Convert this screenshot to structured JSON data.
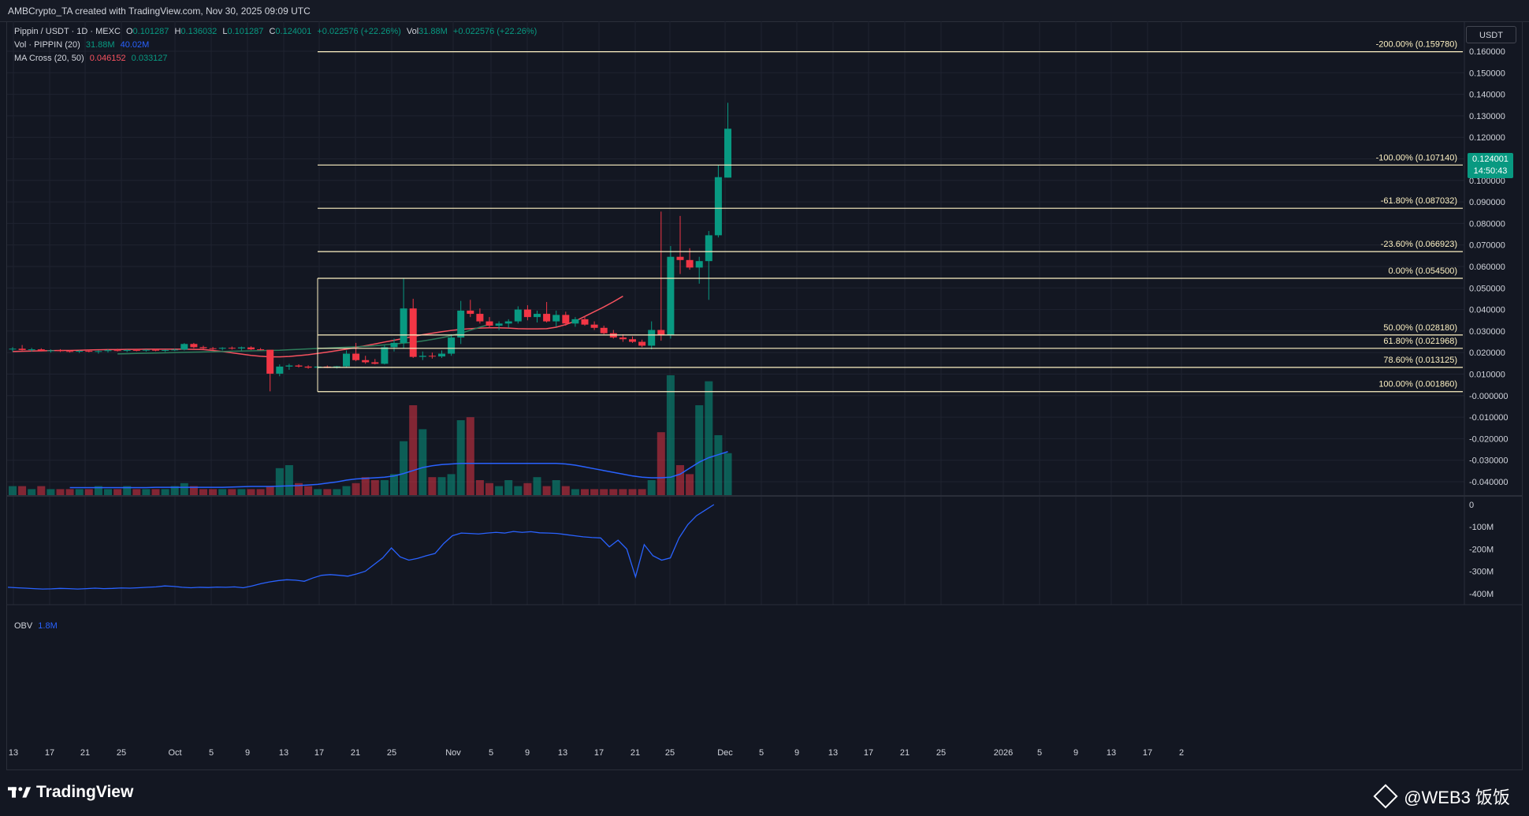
{
  "header": {
    "attribution": "AMBCrypto_TA created with TradingView.com, Nov 30, 2025 09:09 UTC"
  },
  "legend": {
    "symbol": "Pippin / USDT · 1D · MEXC",
    "o_label": "O",
    "o": "0.101287",
    "h_label": "H",
    "h": "0.136032",
    "l_label": "L",
    "l": "0.101287",
    "c_label": "C",
    "c": "0.124001",
    "change": "+0.022576 (+22.26%)",
    "vol_label": "Vol",
    "vol": "31.88M",
    "vol_change": "+0.022576 (+22.26%)",
    "volume_indicator": "Vol · PIPPIN (20)",
    "volume_value": "31.88M",
    "volume_ma": "40.02M",
    "ma_cross": "MA Cross (20, 50)",
    "ma_fast": "0.046152",
    "ma_slow": "0.033127",
    "obv_label": "OBV",
    "obv_value": "1.8M"
  },
  "price_scale": {
    "currency": "USDT",
    "last_price": "0.124001",
    "countdown": "14:50:43"
  },
  "colors": {
    "up": "#089981",
    "down": "#f23645",
    "fib": "#fff3c4",
    "ma_fast": "#f7525f",
    "ma_slow": "#2e7d5b",
    "volume_ma": "#2962ff",
    "obv": "#2962ff"
  },
  "footer": {
    "brand": "TradingView",
    "watermark": "@WEB3 饭饭"
  },
  "chart_data": [
    {
      "type": "candlestick",
      "title": "Pippin / USDT · 1D · MEXC",
      "x_ticks": [
        "13",
        "17",
        "21",
        "25",
        "Oct",
        "5",
        "9",
        "13",
        "17",
        "21",
        "25",
        "Nov",
        "5",
        "9",
        "13",
        "17",
        "21",
        "25",
        "Dec",
        "5",
        "9",
        "13",
        "17",
        "21",
        "25",
        "2026",
        "5",
        "9",
        "13",
        "17",
        "2"
      ],
      "y_ticks": [
        "0.160000",
        "0.150000",
        "0.140000",
        "0.130000",
        "0.120000",
        "0.110000",
        "0.100000",
        "0.090000",
        "0.080000",
        "0.070000",
        "0.060000",
        "0.050000",
        "0.040000",
        "0.030000",
        "0.020000",
        "0.010000",
        "-0.000000",
        "-0.010000",
        "-0.020000",
        "-0.030000",
        "-0.040000"
      ],
      "ylim": [
        -0.045,
        0.166
      ],
      "fib_levels": [
        {
          "label": "-200.00% (0.159780)",
          "value": 0.15978
        },
        {
          "label": "-100.00% (0.107140)",
          "value": 0.10714
        },
        {
          "label": "-61.80% (0.087032)",
          "value": 0.087032
        },
        {
          "label": "-23.60% (0.066923)",
          "value": 0.066923
        },
        {
          "label": "0.00% (0.054500)",
          "value": 0.0545
        },
        {
          "label": "50.00% (0.028180)",
          "value": 0.02818
        },
        {
          "label": "61.80% (0.021968)",
          "value": 0.021968
        },
        {
          "label": "78.60% (0.013125)",
          "value": 0.013125
        },
        {
          "label": "100.00% (0.001860)",
          "value": 0.00186
        }
      ],
      "candles": [
        [
          0.0215,
          0.0225,
          0.0205,
          0.0218
        ],
        [
          0.0218,
          0.0235,
          0.021,
          0.0212
        ],
        [
          0.0212,
          0.0222,
          0.0205,
          0.0215
        ],
        [
          0.0215,
          0.022,
          0.0205,
          0.0209
        ],
        [
          0.0209,
          0.0215,
          0.02,
          0.021
        ],
        [
          0.021,
          0.0216,
          0.0203,
          0.0207
        ],
        [
          0.0207,
          0.0212,
          0.02,
          0.0205
        ],
        [
          0.0205,
          0.0211,
          0.0198,
          0.0208
        ],
        [
          0.0208,
          0.0214,
          0.0201,
          0.0204
        ],
        [
          0.0204,
          0.021,
          0.0195,
          0.0207
        ],
        [
          0.0207,
          0.0215,
          0.02,
          0.0211
        ],
        [
          0.0211,
          0.0218,
          0.0205,
          0.0209
        ],
        [
          0.0209,
          0.0214,
          0.0202,
          0.0212
        ],
        [
          0.0212,
          0.0218,
          0.0206,
          0.021
        ],
        [
          0.021,
          0.0215,
          0.0204,
          0.0213
        ],
        [
          0.0213,
          0.0218,
          0.0206,
          0.0209
        ],
        [
          0.0209,
          0.0214,
          0.0203,
          0.0212
        ],
        [
          0.0212,
          0.0218,
          0.0207,
          0.0214
        ],
        [
          0.0214,
          0.0244,
          0.021,
          0.024
        ],
        [
          0.024,
          0.0245,
          0.022,
          0.0225
        ],
        [
          0.0225,
          0.0232,
          0.0215,
          0.022
        ],
        [
          0.022,
          0.0226,
          0.0212,
          0.0218
        ],
        [
          0.0218,
          0.0225,
          0.021,
          0.0222
        ],
        [
          0.0222,
          0.0228,
          0.0214,
          0.0219
        ],
        [
          0.0219,
          0.0228,
          0.021,
          0.0224
        ],
        [
          0.0224,
          0.0229,
          0.0212,
          0.0215
        ],
        [
          0.0215,
          0.0221,
          0.021,
          0.0213
        ],
        [
          0.0213,
          0.021,
          0.002,
          0.0102
        ],
        [
          0.0102,
          0.0145,
          0.009,
          0.0135
        ],
        [
          0.0135,
          0.0148,
          0.012,
          0.014
        ],
        [
          0.014,
          0.0146,
          0.013,
          0.0135
        ],
        [
          0.0135,
          0.0141,
          0.0125,
          0.013
        ],
        [
          0.013,
          0.0138,
          0.0124,
          0.0135
        ],
        [
          0.0135,
          0.014,
          0.0128,
          0.0132
        ],
        [
          0.0132,
          0.0138,
          0.0126,
          0.0136
        ],
        [
          0.0136,
          0.021,
          0.013,
          0.0195
        ],
        [
          0.0195,
          0.0245,
          0.016,
          0.0165
        ],
        [
          0.0165,
          0.0185,
          0.0148,
          0.0155
        ],
        [
          0.0155,
          0.017,
          0.0145,
          0.0148
        ],
        [
          0.0148,
          0.0235,
          0.0145,
          0.0225
        ],
        [
          0.0225,
          0.0265,
          0.0205,
          0.0245
        ],
        [
          0.0245,
          0.0545,
          0.022,
          0.0405
        ],
        [
          0.0405,
          0.045,
          0.0175,
          0.018
        ],
        [
          0.018,
          0.0205,
          0.0165,
          0.0185
        ],
        [
          0.0185,
          0.02,
          0.0172,
          0.0182
        ],
        [
          0.0182,
          0.021,
          0.0175,
          0.0195
        ],
        [
          0.0195,
          0.0285,
          0.0185,
          0.027
        ],
        [
          0.027,
          0.044,
          0.024,
          0.0395
        ],
        [
          0.0395,
          0.0445,
          0.0365,
          0.038
        ],
        [
          0.038,
          0.0405,
          0.0335,
          0.0345
        ],
        [
          0.0345,
          0.0365,
          0.0315,
          0.0325
        ],
        [
          0.0325,
          0.0345,
          0.0305,
          0.0335
        ],
        [
          0.0335,
          0.0355,
          0.0315,
          0.0345
        ],
        [
          0.0345,
          0.0415,
          0.0335,
          0.04
        ],
        [
          0.04,
          0.042,
          0.035,
          0.0365
        ],
        [
          0.0365,
          0.0395,
          0.034,
          0.038
        ],
        [
          0.038,
          0.0435,
          0.034,
          0.0345
        ],
        [
          0.0345,
          0.0395,
          0.032,
          0.0375
        ],
        [
          0.0375,
          0.039,
          0.0325,
          0.0335
        ],
        [
          0.0335,
          0.0365,
          0.032,
          0.0355
        ],
        [
          0.0355,
          0.037,
          0.0325,
          0.033
        ],
        [
          0.033,
          0.0345,
          0.0305,
          0.0315
        ],
        [
          0.0315,
          0.0325,
          0.0285,
          0.029
        ],
        [
          0.029,
          0.0305,
          0.0265,
          0.027
        ],
        [
          0.027,
          0.0285,
          0.025,
          0.0262
        ],
        [
          0.0262,
          0.0275,
          0.0245,
          0.025
        ],
        [
          0.025,
          0.026,
          0.0225,
          0.0232
        ],
        [
          0.0232,
          0.0345,
          0.0215,
          0.0305
        ],
        [
          0.0305,
          0.0855,
          0.0255,
          0.028
        ],
        [
          0.028,
          0.0695,
          0.0265,
          0.0645
        ],
        [
          0.0645,
          0.0835,
          0.0565,
          0.063
        ],
        [
          0.063,
          0.0685,
          0.0585,
          0.0595
        ],
        [
          0.0595,
          0.0645,
          0.052,
          0.0625
        ],
        [
          0.0625,
          0.0765,
          0.0445,
          0.0745
        ],
        [
          0.0745,
          0.1072,
          0.0735,
          0.1015
        ],
        [
          0.101287,
          0.136032,
          0.101287,
          0.124001
        ]
      ],
      "ma_fast_series": [
        0.0205,
        0.0206,
        0.0207,
        0.0208,
        0.0209,
        0.021,
        0.021,
        0.0211,
        0.0212,
        0.0213,
        0.0214,
        0.0214,
        0.0215,
        0.0215,
        0.0216,
        0.0216,
        0.0216,
        0.0216,
        0.0216,
        0.0215,
        0.0214,
        0.021,
        0.0205,
        0.0199,
        0.0193,
        0.0187,
        0.0183,
        0.018,
        0.018,
        0.0182,
        0.0186,
        0.019,
        0.0196,
        0.0202,
        0.0209,
        0.0216,
        0.0224,
        0.0232,
        0.024,
        0.0249,
        0.0257,
        0.0266,
        0.0275,
        0.0283,
        0.029,
        0.0297,
        0.0303,
        0.0308,
        0.0311,
        0.0314,
        0.0315,
        0.0315,
        0.0314,
        0.0311,
        0.031,
        0.031,
        0.0311,
        0.0318,
        0.033,
        0.0346,
        0.0368,
        0.039,
        0.0412,
        0.0436,
        0.0462
      ],
      "ma_slow_series": [
        0.0194,
        0.0195,
        0.0196,
        0.0197,
        0.0198,
        0.0199,
        0.02,
        0.0201,
        0.0202,
        0.0203,
        0.0204,
        0.0205,
        0.0206,
        0.0207,
        0.0208,
        0.0209,
        0.021,
        0.0211,
        0.0213,
        0.0215,
        0.0217,
        0.0219,
        0.0221,
        0.0223,
        0.0225,
        0.0227,
        0.0229,
        0.0232,
        0.0236,
        0.024,
        0.0244,
        0.0248,
        0.0254,
        0.0261,
        0.0269,
        0.0279,
        0.029,
        0.0304,
        0.0318,
        0.0331
      ]
    },
    {
      "type": "bar",
      "title": "Vol · PIPPIN (20)",
      "volume_series": [
        3,
        3,
        2,
        3,
        2,
        2,
        2,
        2,
        2,
        3,
        2,
        2,
        3,
        2,
        2,
        2,
        2,
        3,
        4,
        3,
        2,
        2,
        2,
        2,
        2,
        2,
        2,
        3,
        9,
        10,
        4,
        3,
        2,
        2,
        2,
        3,
        4,
        6,
        5,
        5,
        7,
        18,
        30,
        22,
        6,
        6,
        7,
        25,
        26,
        5,
        4,
        3,
        5,
        3,
        4,
        6,
        3,
        5,
        3,
        2,
        2,
        2,
        2,
        2,
        2,
        2,
        2,
        5,
        21,
        40,
        10,
        7,
        30,
        38,
        20,
        14
      ],
      "volume_ma_series": [
        2.5,
        2.5,
        2.5,
        2.5,
        2.5,
        2.5,
        2.5,
        2.5,
        2.5,
        2.6,
        2.6,
        2.6,
        2.6,
        2.6,
        2.6,
        2.6,
        2.6,
        2.7,
        2.8,
        2.9,
        2.9,
        2.9,
        3.0,
        3.1,
        3.2,
        3.4,
        3.6,
        4.0,
        4.4,
        5.0,
        5.4,
        5.6,
        5.8,
        6.0,
        6.4,
        7.2,
        8.2,
        9.2,
        9.8,
        10.2,
        10.4,
        10.6,
        10.6,
        10.6,
        10.6,
        10.6,
        10.6,
        10.6,
        10.6,
        10.6,
        10.6,
        10.6,
        10.4,
        10.0,
        9.4,
        8.8,
        8.2,
        7.6,
        7.0,
        6.4,
        6.0,
        5.8,
        5.8,
        6.0,
        7.0,
        9.0,
        11.0,
        12.5,
        13.5,
        14.5
      ]
    },
    {
      "type": "line",
      "title": "OBV",
      "y_ticks": [
        "0",
        "-100M",
        "-200M",
        "-300M",
        "-400M"
      ],
      "ylim": [
        -410,
        5
      ],
      "obv_series": [
        -372,
        -374,
        -376,
        -378,
        -380,
        -379,
        -377,
        -378,
        -380,
        -378,
        -376,
        -378,
        -377,
        -375,
        -376,
        -374,
        -372,
        -370,
        -366,
        -368,
        -372,
        -374,
        -372,
        -373,
        -371,
        -372,
        -370,
        -374,
        -366,
        -356,
        -348,
        -342,
        -338,
        -340,
        -345,
        -330,
        -318,
        -315,
        -318,
        -322,
        -312,
        -300,
        -270,
        -240,
        -195,
        -235,
        -250,
        -242,
        -230,
        -220,
        -175,
        -140,
        -128,
        -130,
        -132,
        -128,
        -125,
        -128,
        -121,
        -125,
        -122,
        -127,
        -128,
        -130,
        -135,
        -140,
        -145,
        -148,
        -150,
        -190,
        -160,
        -200,
        -325,
        -180,
        -230,
        -250,
        -240,
        -150,
        -90,
        -50,
        -25,
        0
      ]
    }
  ]
}
